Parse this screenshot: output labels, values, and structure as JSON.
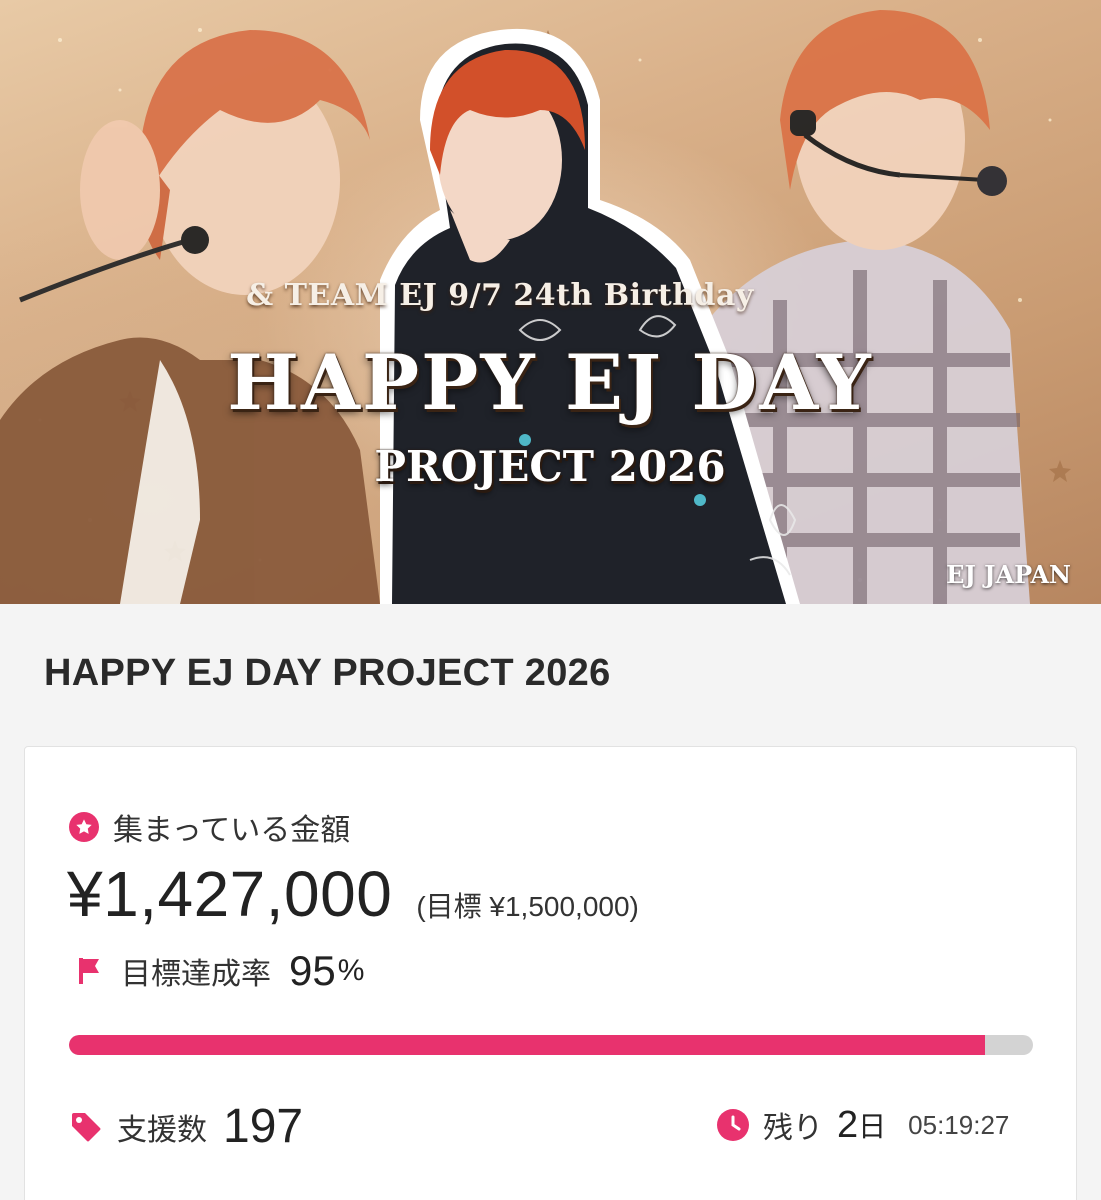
{
  "banner": {
    "sub_title": "& TEAM EJ 9/7 24th Birthday",
    "main_title": "HAPPY EJ DAY",
    "project_title": "PROJECT 2026",
    "watermark": "EJ JAPAN"
  },
  "page_title": "HAPPY EJ DAY PROJECT 2026",
  "funding": {
    "collected_label": "集まっている金額",
    "collected_amount": "¥1,427,000",
    "target_text": "(目標 ¥1,500,000)",
    "achievement_label": "目標達成率",
    "achievement_value": "95",
    "achievement_unit": "%",
    "progress_fraction": 0.95,
    "supporters_label": "支援数",
    "supporters_value": "197",
    "remaining_label": "残り",
    "remaining_days": "2",
    "remaining_days_unit": "日",
    "remaining_time": "05:19:27"
  },
  "colors": {
    "accent": "#e8326e",
    "progress_track": "#d3d3d3",
    "page_background": "#f4f4f4"
  },
  "icons": [
    "star-icon",
    "flag-icon",
    "tag-icon",
    "clock-icon"
  ]
}
